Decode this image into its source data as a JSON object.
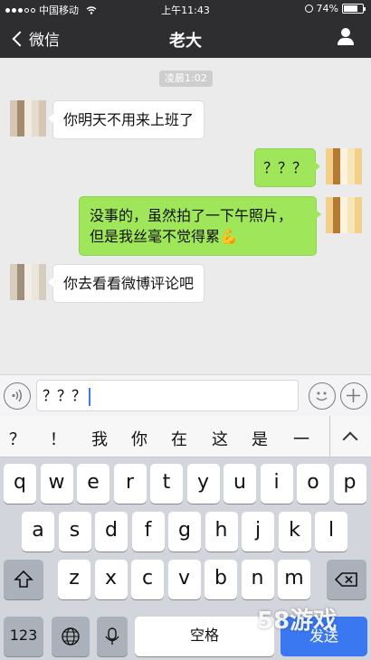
{
  "status": {
    "carrier": "中国移动",
    "time": "上午11:43",
    "battery": "74%",
    "battery_level": 0.74
  },
  "nav": {
    "back_label": "微信",
    "title": "老大"
  },
  "chat": {
    "timestamp": "凌晨1:02",
    "messages": [
      {
        "side": "in",
        "text": "你明天不用来上班了"
      },
      {
        "side": "out",
        "text": "？？？"
      },
      {
        "side": "out",
        "text": "没事的，虽然拍了一下午照片，但是我丝毫不觉得累💪"
      },
      {
        "side": "in",
        "text": "你去看看微博评论吧"
      }
    ]
  },
  "input": {
    "value": "？？？"
  },
  "keyboard": {
    "suggestions": [
      "？",
      "！",
      "我",
      "你",
      "在",
      "这",
      "是",
      "一"
    ],
    "row1": [
      "q",
      "w",
      "e",
      "r",
      "t",
      "y",
      "u",
      "i",
      "o",
      "p"
    ],
    "row2": [
      "a",
      "s",
      "d",
      "f",
      "g",
      "h",
      "j",
      "k",
      "l"
    ],
    "row3": [
      "z",
      "x",
      "c",
      "v",
      "b",
      "n",
      "m"
    ],
    "num_label": "123",
    "space_label": "空格",
    "send_label": "发送"
  },
  "watermark": "58游戏",
  "colors": {
    "navbar": "#2e2e31",
    "out_bubble": "#9fe65a",
    "send": "#3a78f2"
  }
}
